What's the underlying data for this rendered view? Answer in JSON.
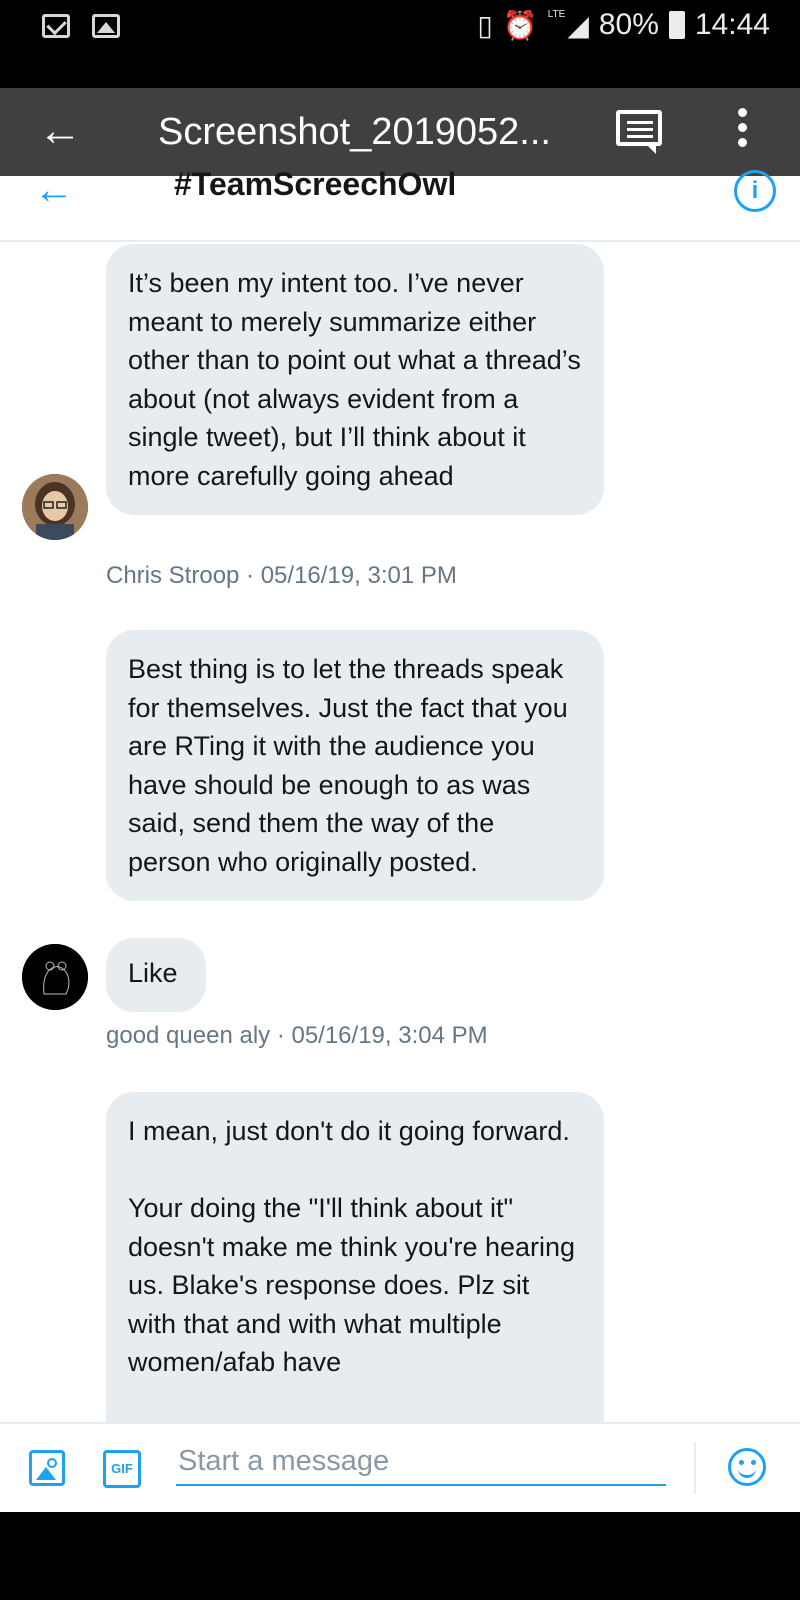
{
  "status_bar": {
    "lte": "LTE",
    "battery": "80%",
    "time": "14:44",
    "icons": [
      "gmail-icon",
      "gallery-icon",
      "vibrate-icon",
      "alarm-icon",
      "signal-icon",
      "battery-icon"
    ]
  },
  "viewer": {
    "back": "←",
    "title": "Screenshot_2019052..."
  },
  "header": {
    "back": "←",
    "title": "#TeamScreechOwl",
    "info": "i"
  },
  "messages": [
    {
      "text": "It’s been my intent too. I’ve never meant to merely summarize either other than to point out what a thread’s about (not always evident from a single tweet), but I’ll think about it more carefully going ahead",
      "author": "Chris Stroop",
      "timestamp": "05/16/19, 3:01 PM",
      "meta": "Chris Stroop · 05/16/19, 3:01 PM"
    },
    {
      "text": "Best thing is to let the threads speak for themselves.  Just the fact that you are RTing it with the audience you have should be enough to as was\nsaid, send them the way of the person who originally posted."
    },
    {
      "text": "Like",
      "meta": "good queen aly · 05/16/19, 3:04 PM"
    },
    {
      "text": "I mean, just don't do it going forward.\n\nYour doing the \"I'll think about it\" doesn't make me think you're hearing us. Blake's response does. Plz sit with that and with what multiple women/afab have"
    }
  ],
  "composer": {
    "placeholder": "Start a message",
    "gif_label": "GIF"
  },
  "colors": {
    "accent": "#1da1f2",
    "bubble": "#e6ecf0",
    "meta_text": "#657786"
  }
}
